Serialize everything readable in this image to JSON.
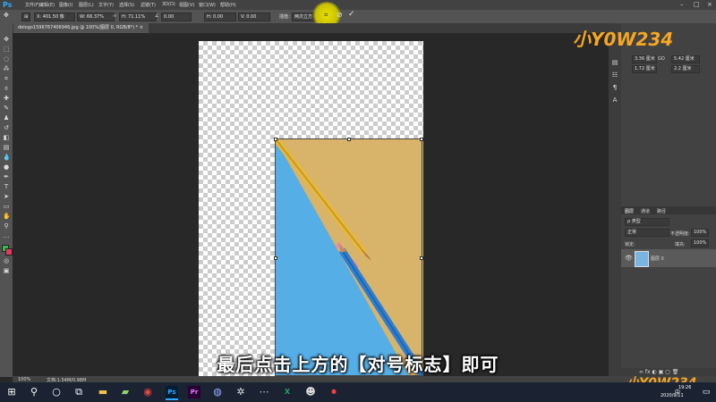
{
  "app": {
    "logo": "Ps",
    "menu": [
      "文件(F)",
      "编辑(E)",
      "图像(I)",
      "图层(L)",
      "文字(Y)",
      "选择(S)",
      "滤镜(T)",
      "3D(D)",
      "视图(V)",
      "窗口(W)",
      "帮助(H)"
    ]
  },
  "options_bar": {
    "x_value": "X: 401.50 像",
    "w_value": "W: 66.37%",
    "h_value": "H: 71.11%",
    "angle_value": "0.00",
    "h_skew": "H: 0.00",
    "v_skew": "V: 0.00",
    "interp_label": "插值：",
    "interp_value": "两次立方"
  },
  "document_tab": {
    "title": "delogo1596767406946.jpg @ 100%(图层 0, RGB/8*) *  ×"
  },
  "status_bar": {
    "zoom": "100%",
    "doc_info": "文档:1.54M/0.98M"
  },
  "properties_panel": {
    "w": "3.36 厘米",
    "go": "GO",
    "h": "5.42 厘米",
    "x": "1.72 厘米",
    "y": "2.2 厘米"
  },
  "layers_panel": {
    "tabs": [
      "图层",
      "通道",
      "路径"
    ],
    "kind_label": "ρ 类型",
    "blend_mode": "正常",
    "opacity_label": "不透明度:",
    "opacity_value": "100%",
    "lock_label": "锁定:",
    "fill_label": "填充:",
    "fill_value": "100%",
    "layer_name": "图层 0"
  },
  "subtitle": "最后点击上方的【对号标志】即可",
  "watermark": "小Y0W234",
  "taskbar": {
    "ime": "中",
    "time": "19:26",
    "date": "2020/9/11"
  },
  "colors": {
    "accent_highlight": "#e8e000",
    "ps_blue": "#31a8ff",
    "photo_blue": "#55aee6",
    "photo_yellow": "#d8b36a"
  }
}
